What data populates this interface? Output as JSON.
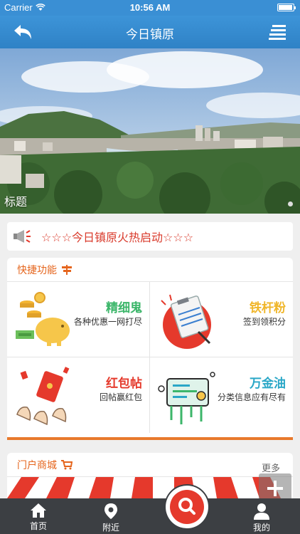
{
  "status_bar": {
    "carrier": "Carrier",
    "time": "10:56 AM"
  },
  "nav": {
    "title": "今日镇原",
    "back_icon": "back-arrow-icon",
    "menu_icon": "list-menu-icon"
  },
  "banner": {
    "caption": "标题"
  },
  "notice": {
    "text": "☆☆☆今日镇原火热启动☆☆☆",
    "icon": "megaphone-icon"
  },
  "quick": {
    "title": "快捷功能",
    "icon": "signpost-icon",
    "items": [
      {
        "title": "精细鬼",
        "subtitle": "各种优惠一网打尽",
        "color": "#3cb66a"
      },
      {
        "title": "铁杆粉",
        "subtitle": "签到领积分",
        "color": "#f0b62a"
      },
      {
        "title": "红包帖",
        "subtitle": "回帖赢红包",
        "color": "#e53a2c"
      },
      {
        "title": "万金油",
        "subtitle": "分类信息应有尽有",
        "color": "#2aa7c7"
      }
    ]
  },
  "mall": {
    "title": "门户商城",
    "icon": "shopping-cart-icon"
  },
  "more": {
    "label": "更多"
  },
  "tabs": [
    {
      "label": "首页",
      "icon": "home-icon"
    },
    {
      "label": "附近",
      "icon": "location-pin-icon"
    },
    {
      "label": "我的",
      "icon": "user-icon"
    }
  ],
  "colors": {
    "primary": "#3a8fd4",
    "accent": "#e5651d",
    "red": "#e5392c",
    "tabbar": "#3c3f43"
  }
}
